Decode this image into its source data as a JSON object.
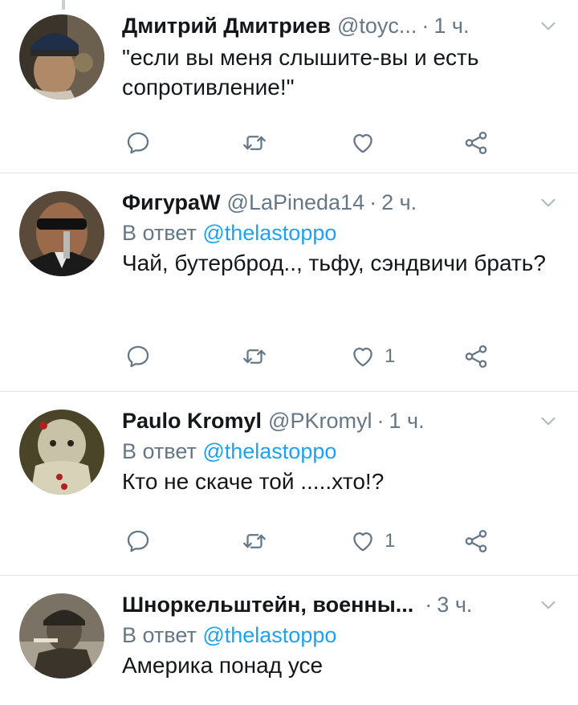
{
  "tweets": [
    {
      "name": "Дмитрий Дмитриев",
      "handle": "@toyc...",
      "separator": "·",
      "time": "1 ч.",
      "reply_prefix": "",
      "reply_to": "",
      "text": "\"если вы меня слышите-вы и есть сопротивление!\"",
      "like_count": ""
    },
    {
      "name": "ФигураW",
      "handle": "@LaPineda14",
      "separator": "·",
      "time": "2 ч.",
      "reply_prefix": "В ответ",
      "reply_to": "@thelastoppo",
      "text": "Чай, бутерброд.., тьфу, сэндвичи брать?",
      "like_count": "1"
    },
    {
      "name": "Paulo Kromyl",
      "handle": "@PKromyl",
      "separator": "·",
      "time": "1 ч.",
      "reply_prefix": "В ответ",
      "reply_to": "@thelastoppo",
      "text": "Кто не скаче той .....хто!?",
      "like_count": "1"
    },
    {
      "name": "Шноркельштейн, военны...",
      "handle": "",
      "separator": "·",
      "time": "3 ч.",
      "reply_prefix": "В ответ",
      "reply_to": "@thelastoppo",
      "text": "Америка понад усе",
      "like_count": ""
    }
  ],
  "icons": {
    "reply": "reply-icon",
    "retweet": "retweet-icon",
    "like": "heart-icon",
    "share": "share-icon",
    "menu": "chevron-down-icon"
  },
  "colors": {
    "text": "#14171a",
    "secondary": "#657786",
    "link": "#1da1f2",
    "divider": "#e1e8ed"
  }
}
